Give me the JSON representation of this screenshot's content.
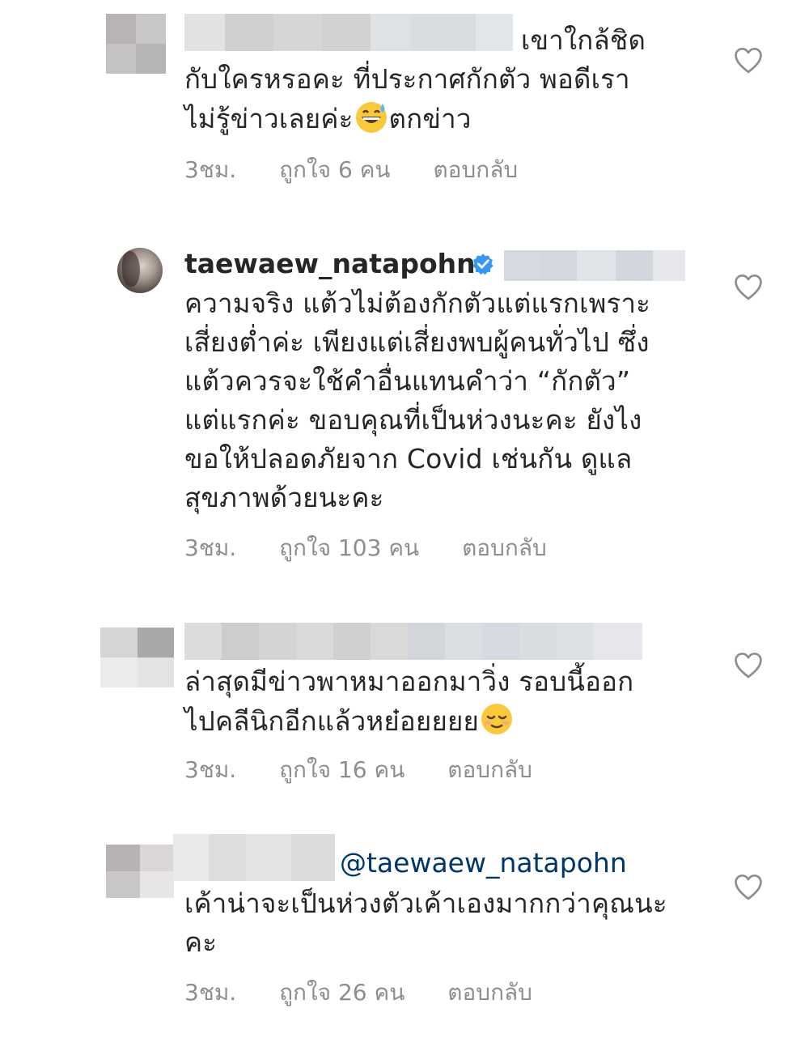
{
  "comments": [
    {
      "text_lines": [
        "เขาใกล้ชิด",
        "กับใครหรอคะ ที่ประกาศกักตัว พอดีเรา",
        "ไม่รู้ข่าวเลยค่ะ"
      ],
      "text_after_emoji": "ตกข่าว",
      "emoji": "grinning-sweat-emoji",
      "time": "3ชม.",
      "likes": "ถูกใจ 6 คน",
      "reply": "ตอบกลับ"
    },
    {
      "username": "taewaew_natapohn",
      "text_lines": [
        "ความจริง แต้วไม่ต้องกักตัวแต่แรกเพราะ",
        "เสี่ยงต่ำค่ะ เพียงแต่เสี่ยงพบผู้คนทั่วไป ซึ่ง",
        "แต้วควรจะใช้คำอื่นแทนคำว่า “กักตัว”",
        "แต่แรกค่ะ ขอบคุณที่เป็นห่วงนะคะ ยังไง",
        "ขอให้ปลอดภัยจาก Covid เช่นกัน ดูแล",
        "สุขภาพด้วยนะคะ"
      ],
      "time": "3ชม.",
      "likes": "ถูกใจ 103 คน",
      "reply": "ตอบกลับ"
    },
    {
      "text_lines": [
        "ล่าสุดมีข่าวพาหมาออกมาวิ่ง รอบนี้ออก",
        "ไปคลีนิกอีกแล้วหย๋อยยยย"
      ],
      "emoji": "relieved-face-emoji",
      "time": "3ชม.",
      "likes": "ถูกใจ 16 คน",
      "reply": "ตอบกลับ"
    },
    {
      "mention": "@taewaew_natapohn",
      "text_lines": [
        "เค้าน่าจะเป็นห่วงตัวเค้าเองมากกว่าคุณนะ",
        "คะ"
      ],
      "time": "3ชม.",
      "likes": "ถูกใจ 26 คน",
      "reply": "ตอบกลับ"
    }
  ],
  "colors": {
    "text": "#262626",
    "meta": "#8e8e8e",
    "mention": "#00376b",
    "verified": "#3897f0",
    "heart_outline": "#8e8e8e"
  }
}
